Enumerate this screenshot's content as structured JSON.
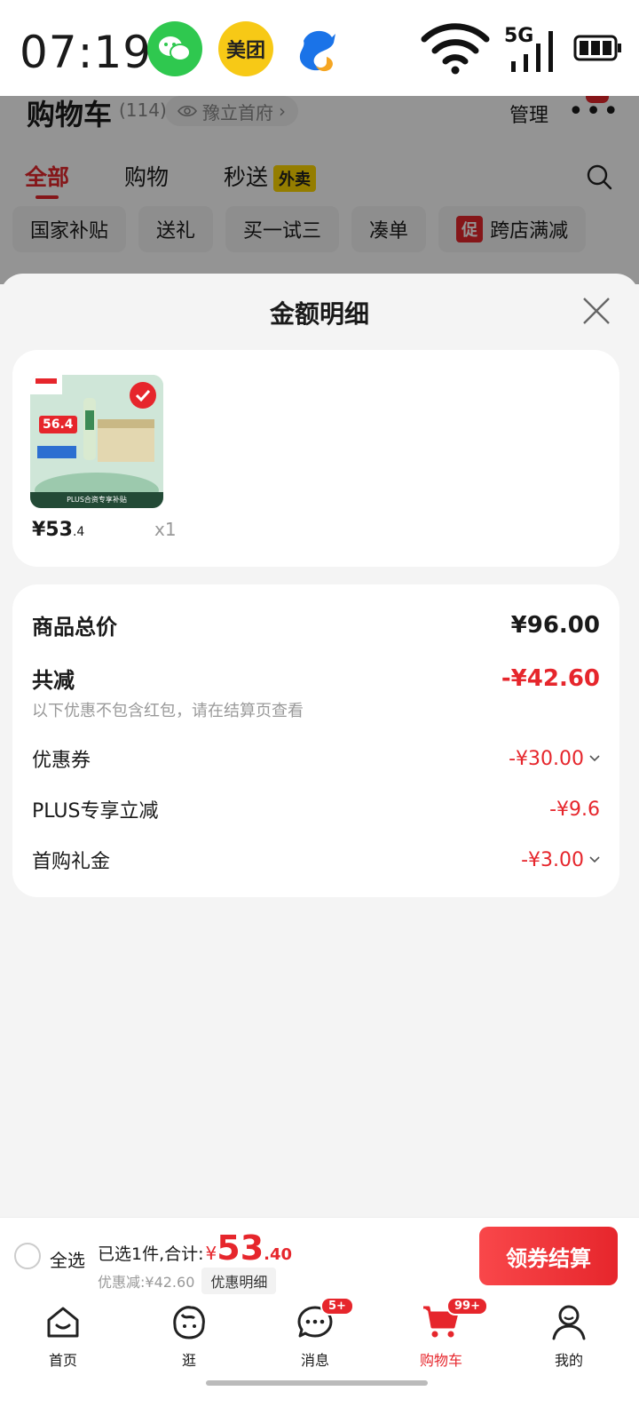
{
  "status_bar": {
    "time": "07:19",
    "meituan_label": "美团",
    "network": "5G"
  },
  "background": {
    "title": "购物车",
    "count": "(114)",
    "location": "豫立首府",
    "manage": "管理",
    "tabs": [
      "全部",
      "购物",
      "秒送"
    ],
    "waimai_tag": "外卖",
    "chips": [
      "国家补贴",
      "送礼",
      "买一试三",
      "凑单",
      "跨店满减"
    ],
    "promo_tag": "促"
  },
  "sheet": {
    "title": "金额明细",
    "item": {
      "price_main": "¥53",
      "price_dec": ".4",
      "qty": "x1",
      "thumb_price": "56.4",
      "thumb_banner": "PLUS合资专享补贴"
    },
    "total_label": "商品总价",
    "total_value": "¥96.00",
    "reduce_label": "共减",
    "reduce_value": "-¥42.60",
    "note": "以下优惠不包含红包，请在结算页查看",
    "lines": [
      {
        "label": "优惠券",
        "value": "-¥30.00",
        "has_chevron": true
      },
      {
        "label": "PLUS专享立减",
        "value": "-¥9.6",
        "has_chevron": false
      },
      {
        "label": "首购礼金",
        "value": "-¥3.00",
        "has_chevron": true
      }
    ]
  },
  "checkout": {
    "select_all": "全选",
    "selected_text": "已选1件,合计:",
    "yen": "¥",
    "total_int": "53",
    "total_dec": ".40",
    "discount_text": "优惠减:¥42.60",
    "detail_tag": "优惠明细",
    "button": "领券结算"
  },
  "tabbar": [
    {
      "label": "首页"
    },
    {
      "label": "逛"
    },
    {
      "label": "消息",
      "badge": "5+"
    },
    {
      "label": "购物车",
      "badge": "99+"
    },
    {
      "label": "我的"
    }
  ],
  "colors": {
    "accent": "#e6262c"
  }
}
